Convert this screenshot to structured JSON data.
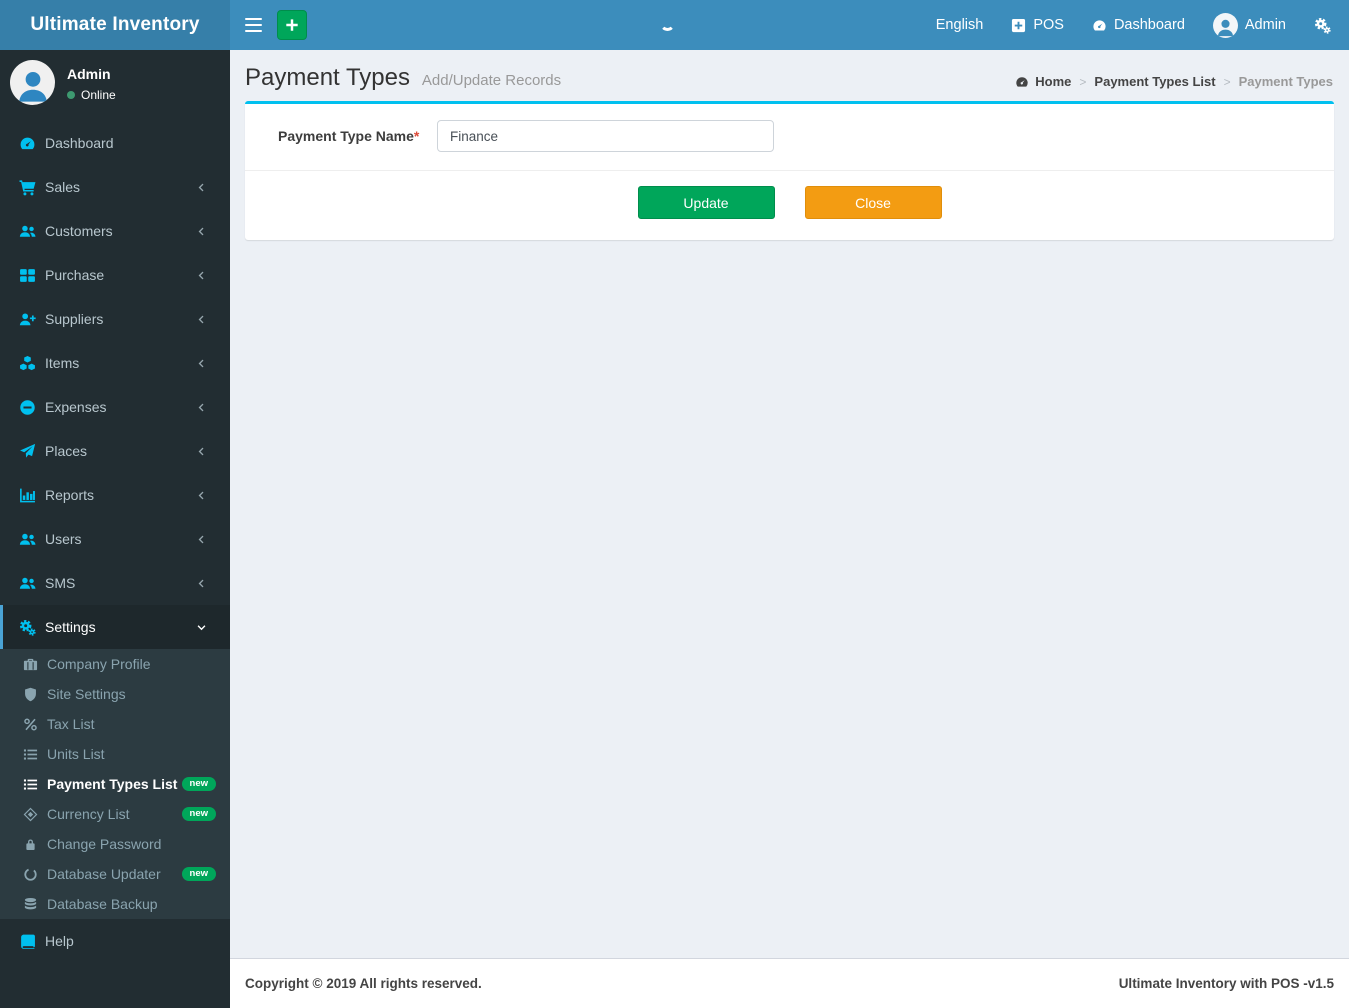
{
  "colors": {
    "navbar_bg": "#3c8dbc",
    "logo_bg": "#367fa9",
    "sidebar_bg": "#222d32",
    "submenu_bg": "#2c3b41",
    "active_item_bg": "#1e282c",
    "active_item_border": "#4aa3d5",
    "sidebar_icon_accent": "#00c0ef",
    "success_green": "#00a65a",
    "warning_orange": "#f39c12",
    "box_top_border": "#00c0ef",
    "content_bg": "#ecf0f5",
    "required_red": "#dd4b39"
  },
  "navbar": {
    "brand": "Ultimate Inventory",
    "hamburger_icon": "hamburger-icon",
    "add_button_icon": "plus-icon",
    "spinner_icon": "loading-spinner",
    "language": "English",
    "pos": "POS",
    "dashboard": "Dashboard",
    "user": "Admin",
    "settings_icon": "gears-icon"
  },
  "sidebar": {
    "user": {
      "name": "Admin",
      "status": "Online"
    },
    "items": [
      {
        "label": "Dashboard",
        "icon": "gauge-icon"
      },
      {
        "label": "Sales",
        "icon": "cart-icon"
      },
      {
        "label": "Customers",
        "icon": "users-icon"
      },
      {
        "label": "Purchase",
        "icon": "grid-icon"
      },
      {
        "label": "Suppliers",
        "icon": "user-plus-icon"
      },
      {
        "label": "Items",
        "icon": "cubes-icon"
      },
      {
        "label": "Expenses",
        "icon": "minus-circle-icon"
      },
      {
        "label": "Places",
        "icon": "paper-plane-icon"
      },
      {
        "label": "Reports",
        "icon": "bar-chart-icon"
      },
      {
        "label": "Users",
        "icon": "users-icon"
      },
      {
        "label": "SMS",
        "icon": "users-icon"
      },
      {
        "label": "Settings",
        "icon": "gears-icon"
      }
    ],
    "submenu": [
      {
        "label": "Company Profile",
        "icon": "briefcase-icon"
      },
      {
        "label": "Site Settings",
        "icon": "shield-icon"
      },
      {
        "label": "Tax List",
        "icon": "percent-icon"
      },
      {
        "label": "Units List",
        "icon": "list-icon"
      },
      {
        "label": "Payment Types List",
        "icon": "list-icon",
        "badge": "new"
      },
      {
        "label": "Currency List",
        "icon": "diamond-icon",
        "badge": "new"
      },
      {
        "label": "Change Password",
        "icon": "lock-icon"
      },
      {
        "label": "Database Updater",
        "icon": "circle-icon",
        "badge": "new"
      },
      {
        "label": "Database Backup",
        "icon": "database-icon"
      }
    ],
    "help": {
      "label": "Help",
      "icon": "book-icon"
    }
  },
  "page": {
    "title": "Payment Types",
    "subtitle": "Add/Update Records",
    "breadcrumb": {
      "home": "Home",
      "parent": "Payment Types List",
      "current": "Payment Types",
      "separator": ">"
    }
  },
  "form": {
    "name_label": "Payment Type Name",
    "required_mark": "*",
    "name_value": "Finance",
    "update_label": "Update",
    "close_label": "Close"
  },
  "footer": {
    "copyright": "Copyright © 2019 All rights reserved.",
    "version": "Ultimate Inventory with POS -v1.5"
  }
}
